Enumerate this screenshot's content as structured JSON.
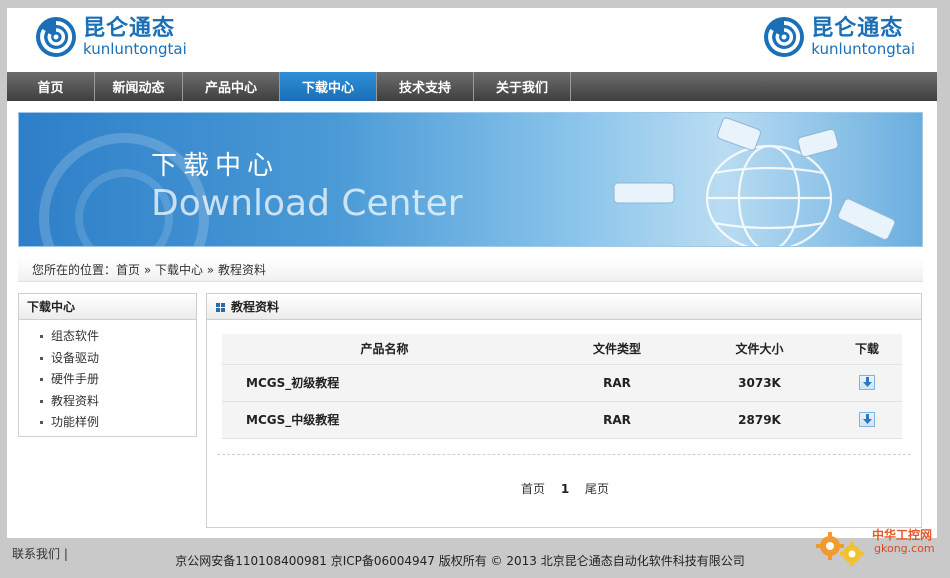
{
  "brand": {
    "name_cn": "昆仑通态",
    "name_en": "kunluntongtai",
    "color": "#1a6fb7"
  },
  "nav": {
    "items": [
      {
        "label": "首页"
      },
      {
        "label": "新闻动态"
      },
      {
        "label": "产品中心"
      },
      {
        "label": "下载中心"
      },
      {
        "label": "技术支持"
      },
      {
        "label": "关于我们"
      }
    ],
    "active_index": 3,
    "active_color": "#1a6fb7"
  },
  "banner": {
    "title_cn": "下载中心",
    "title_en": "Download Center"
  },
  "breadcrumb": {
    "text": "您所在的位置：首页 » 下载中心 » 教程资料"
  },
  "sidebar": {
    "title": "下载中心",
    "items": [
      {
        "label": "组态软件"
      },
      {
        "label": "设备驱动"
      },
      {
        "label": "硬件手册"
      },
      {
        "label": "教程资料"
      },
      {
        "label": "功能样例"
      }
    ]
  },
  "main": {
    "title": "教程资料",
    "table": {
      "headers": [
        "产品名称",
        "文件类型",
        "文件大小",
        "下载"
      ],
      "rows": [
        {
          "name": "MCGS_初级教程",
          "type": "RAR",
          "size": "3073K",
          "download_icon": "download-arrow-icon"
        },
        {
          "name": "MCGS_中级教程",
          "type": "RAR",
          "size": "2879K",
          "download_icon": "download-arrow-icon"
        }
      ]
    },
    "pager": {
      "first": "首页",
      "current": "1",
      "last": "尾页"
    }
  },
  "footer": {
    "contact": "联系我们 |",
    "copyright": "京公网安备110108400981 京ICP备06004947 版权所有 © 2013 北京昆仑通态自动化软件科技有限公司"
  },
  "watermark": {
    "text_cn": "中华工控网",
    "text_en": "gkong.com"
  }
}
